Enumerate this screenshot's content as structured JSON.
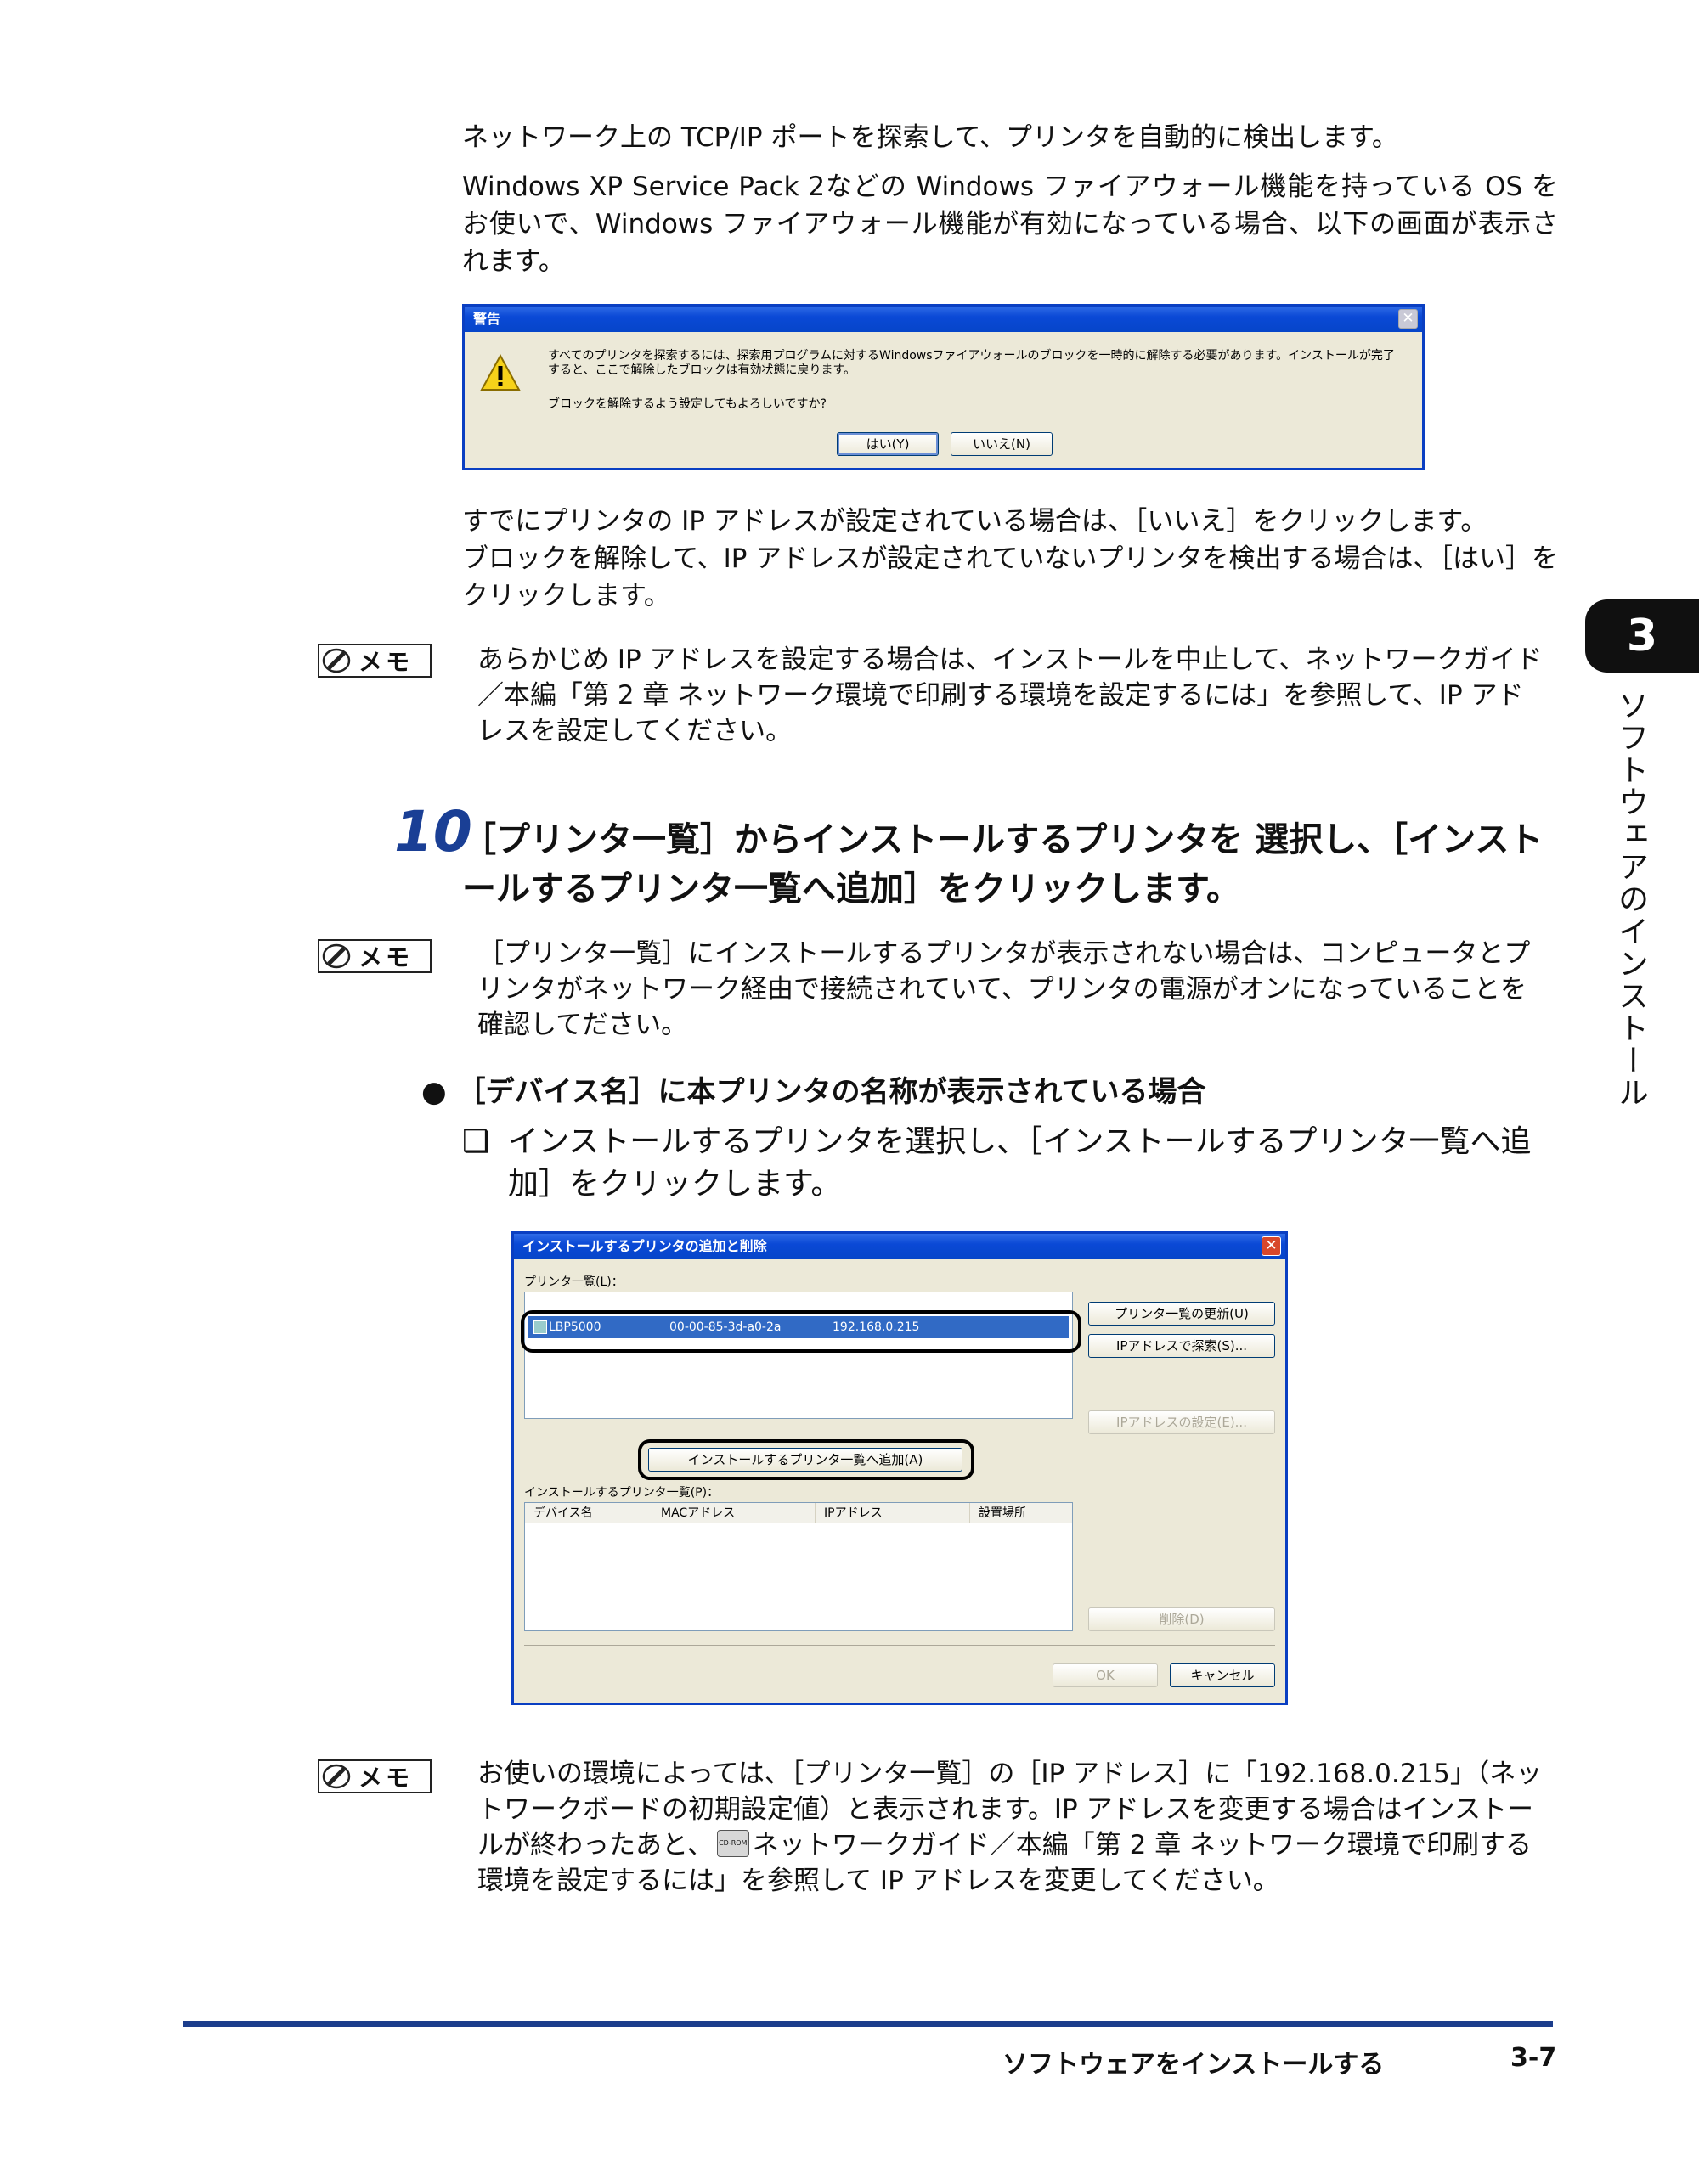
{
  "intro": {
    "p1": "ネットワーク上の TCP/IP ポートを探索して、プリンタを自動的に検出します。",
    "p2": "Windows XP Service Pack 2などの Windows ファイアウォール機能を持っている OS をお使いで、Windows ファイアウォール機能が有効になっている場合、以下の画面が表示されます。"
  },
  "warning_dialog": {
    "title": "警告",
    "message": "すべてのプリンタを探索するには、探索用プログラムに対するWindowsファイアウォールのブロックを一時的に解除する必要があります。インストールが完了すると、ここで解除したブロックは有効状態に戻ります。",
    "question": "ブロックを解除するよう設定してもよろしいですか?",
    "yes_label": "はい(Y)",
    "no_label": "いいえ(N)",
    "icon": "warning-icon"
  },
  "after_dialog": {
    "p1": "すでにプリンタの IP アドレスが設定されている場合は、［いいえ］をクリックします。",
    "p2": "ブロックを解除して、IP アドレスが設定されていないプリンタを検出する場合は、［はい］をクリックします。"
  },
  "memo_label": "メモ",
  "memo1": "あらかじめ IP アドレスを設定する場合は、インストールを中止して、ネットワークガイド／本編「第 2 章 ネットワーク環境で印刷する環境を設定するには」を参照して、IP アドレスを設定してください。",
  "step": {
    "number": "10",
    "text": "［プリンタ一覧］からインストールするプリンタを 選択し、［インストールするプリンタ一覧へ追加］をクリックします。"
  },
  "memo2": "［プリンタ一覧］にインストールするプリンタが表示されない場合は、コンピュータとプリンタがネットワーク経由で接続されていて、プリンタの電源がオンになっていることを確認してださい。",
  "bullet": "［デバイス名］に本プリンタの名称が表示されている場合",
  "checkbox_item": "インストールするプリンタを選択し、［インストールするプリンタ一覧へ追加］をクリックします。",
  "install_dialog": {
    "title": "インストールするプリンタの追加と削除",
    "printer_list_label": "プリンタ一覧(L)：",
    "row": {
      "device": "LBP5000",
      "mac": "00-00-85-3d-a0-2a",
      "ip": "192.168.0.215"
    },
    "btn_refresh": "プリンタ一覧の更新(U)",
    "btn_search_ip": "IPアドレスで探索(S)...",
    "btn_set_ip": "IPアドレスの設定(E)...",
    "btn_add": "インストールするプリンタ一覧へ追加(A)",
    "install_list_label": "インストールするプリンタ一覧(P)：",
    "columns": [
      "デバイス名",
      "MACアドレス",
      "IPアドレス",
      "設置場所"
    ],
    "btn_delete": "削除(D)",
    "btn_ok": "OK",
    "btn_cancel": "キャンセル"
  },
  "memo3": "お使いの環境によっては、［プリンタ一覧］の［IP アドレス］に「192.168.0.215」（ネットワークボードの初期設定値）と表示されます。IP アドレスを変更する場合はインストールが終わったあと、",
  "memo3_cd": "CD-ROM",
  "memo3_tail": "ネットワークガイド／本編「第 2 章 ネットワーク環境で印刷する環境を設定するには」を参照して IP アドレスを変更してください。",
  "side_tab": {
    "number": "3",
    "title": "ソフトウェアのインストール"
  },
  "footer": {
    "section": "ソフトウェアをインストールする",
    "page": "3-7"
  },
  "colors": {
    "rule": "#1c3d8c",
    "xp_blue": "#0a49d6",
    "selection": "#316ac5"
  }
}
